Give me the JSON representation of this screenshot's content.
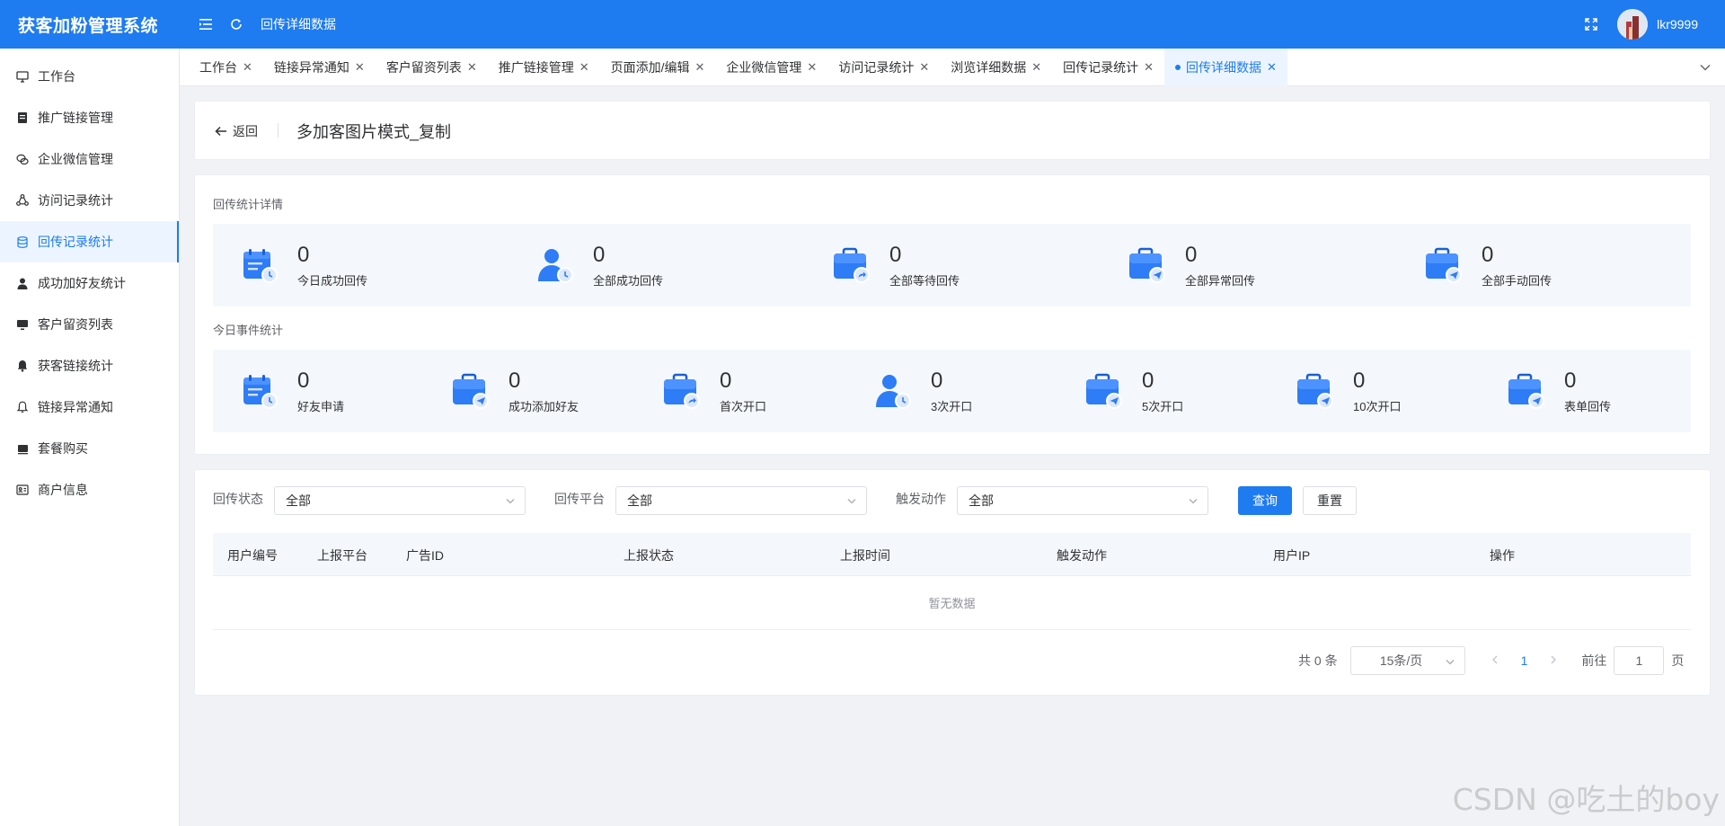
{
  "app": {
    "title": "获客加粉管理系统",
    "page_title": "回传详细数据",
    "username": "lkr9999"
  },
  "sidebar": {
    "items": [
      {
        "label": "工作台",
        "icon": "monitor-icon"
      },
      {
        "label": "推广链接管理",
        "icon": "document-icon"
      },
      {
        "label": "企业微信管理",
        "icon": "chat-icon"
      },
      {
        "label": "访问记录统计",
        "icon": "share-icon"
      },
      {
        "label": "回传记录统计",
        "icon": "database-icon",
        "active": true
      },
      {
        "label": "成功加好友统计",
        "icon": "user-icon"
      },
      {
        "label": "客户留资列表",
        "icon": "screen-icon"
      },
      {
        "label": "获客链接统计",
        "icon": "bell-icon"
      },
      {
        "label": "链接异常通知",
        "icon": "bell-outline-icon"
      },
      {
        "label": "套餐购买",
        "icon": "box-icon"
      },
      {
        "label": "商户信息",
        "icon": "id-card-icon"
      }
    ]
  },
  "tabs": [
    {
      "label": "工作台"
    },
    {
      "label": "链接异常通知"
    },
    {
      "label": "客户留资列表"
    },
    {
      "label": "推广链接管理"
    },
    {
      "label": "页面添加/编辑"
    },
    {
      "label": "企业微信管理"
    },
    {
      "label": "访问记录统计"
    },
    {
      "label": "浏览详细数据"
    },
    {
      "label": "回传记录统计"
    },
    {
      "label": "回传详细数据",
      "active": true
    }
  ],
  "detail": {
    "back_label": "返回",
    "name": "多加客图片模式_复制"
  },
  "stats": {
    "section1_label": "回传统计详情",
    "section1": [
      {
        "value": "0",
        "label": "今日成功回传",
        "icon": "calendar-clock-icon"
      },
      {
        "value": "0",
        "label": "全部成功回传",
        "icon": "user-clock-icon"
      },
      {
        "value": "0",
        "label": "全部等待回传",
        "icon": "briefcase-share-icon"
      },
      {
        "value": "0",
        "label": "全部异常回传",
        "icon": "briefcase-send-icon"
      },
      {
        "value": "0",
        "label": "全部手动回传",
        "icon": "briefcase-send-icon"
      }
    ],
    "section2_label": "今日事件统计",
    "section2": [
      {
        "value": "0",
        "label": "好友申请",
        "icon": "calendar-clock-icon"
      },
      {
        "value": "0",
        "label": "成功添加好友",
        "icon": "briefcase-send-icon"
      },
      {
        "value": "0",
        "label": "首次开口",
        "icon": "briefcase-share-icon"
      },
      {
        "value": "0",
        "label": "3次开口",
        "icon": "user-clock-icon"
      },
      {
        "value": "0",
        "label": "5次开口",
        "icon": "briefcase-send-icon"
      },
      {
        "value": "0",
        "label": "10次开口",
        "icon": "briefcase-send-icon"
      },
      {
        "value": "0",
        "label": "表单回传",
        "icon": "briefcase-send-icon"
      }
    ]
  },
  "filters": {
    "status": {
      "label": "回传状态",
      "value": "全部"
    },
    "platform": {
      "label": "回传平台",
      "value": "全部"
    },
    "action": {
      "label": "触发动作",
      "value": "全部"
    },
    "query_label": "查询",
    "reset_label": "重置"
  },
  "table": {
    "columns": [
      "用户编号",
      "上报平台",
      "广告ID",
      "上报状态",
      "上报时间",
      "触发动作",
      "用户IP",
      "操作"
    ],
    "empty_text": "暂无数据"
  },
  "pagination": {
    "total_text": "共 0 条",
    "page_size": "15条/页",
    "current_page": "1",
    "goto_label": "前往",
    "goto_value": "1",
    "page_suffix": "页"
  },
  "watermark": "CSDN @吃土的boy",
  "colors": {
    "primary": "#1e7bf0",
    "stat_bg": "#f4f8fd"
  }
}
